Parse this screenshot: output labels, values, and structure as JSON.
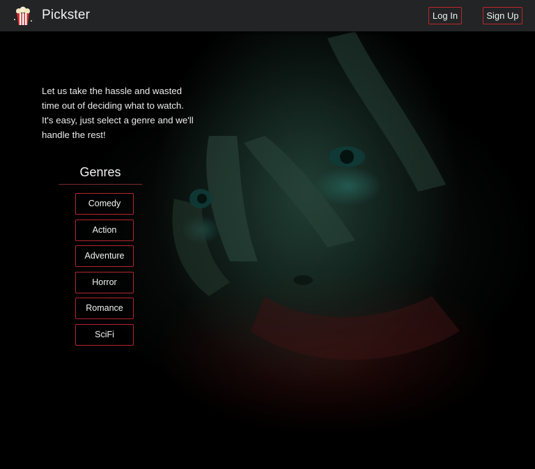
{
  "header": {
    "brand": "Pickster",
    "logo_icon": "popcorn-icon",
    "login_label": "Log In",
    "signup_label": "Sign Up"
  },
  "hero": {
    "tagline": "Let us take the hassle and wasted time out of deciding what to watch. It's easy, just select a genre and we'll handle the rest!"
  },
  "genres": {
    "title": "Genres",
    "items": [
      "Comedy",
      "Action",
      "Adventure",
      "Horror",
      "Romance",
      "SciFi"
    ]
  },
  "colors": {
    "navbar_bg": "#222425",
    "accent_border": "#c0262e",
    "text": "#f2f2f2",
    "page_bg": "#000000"
  }
}
